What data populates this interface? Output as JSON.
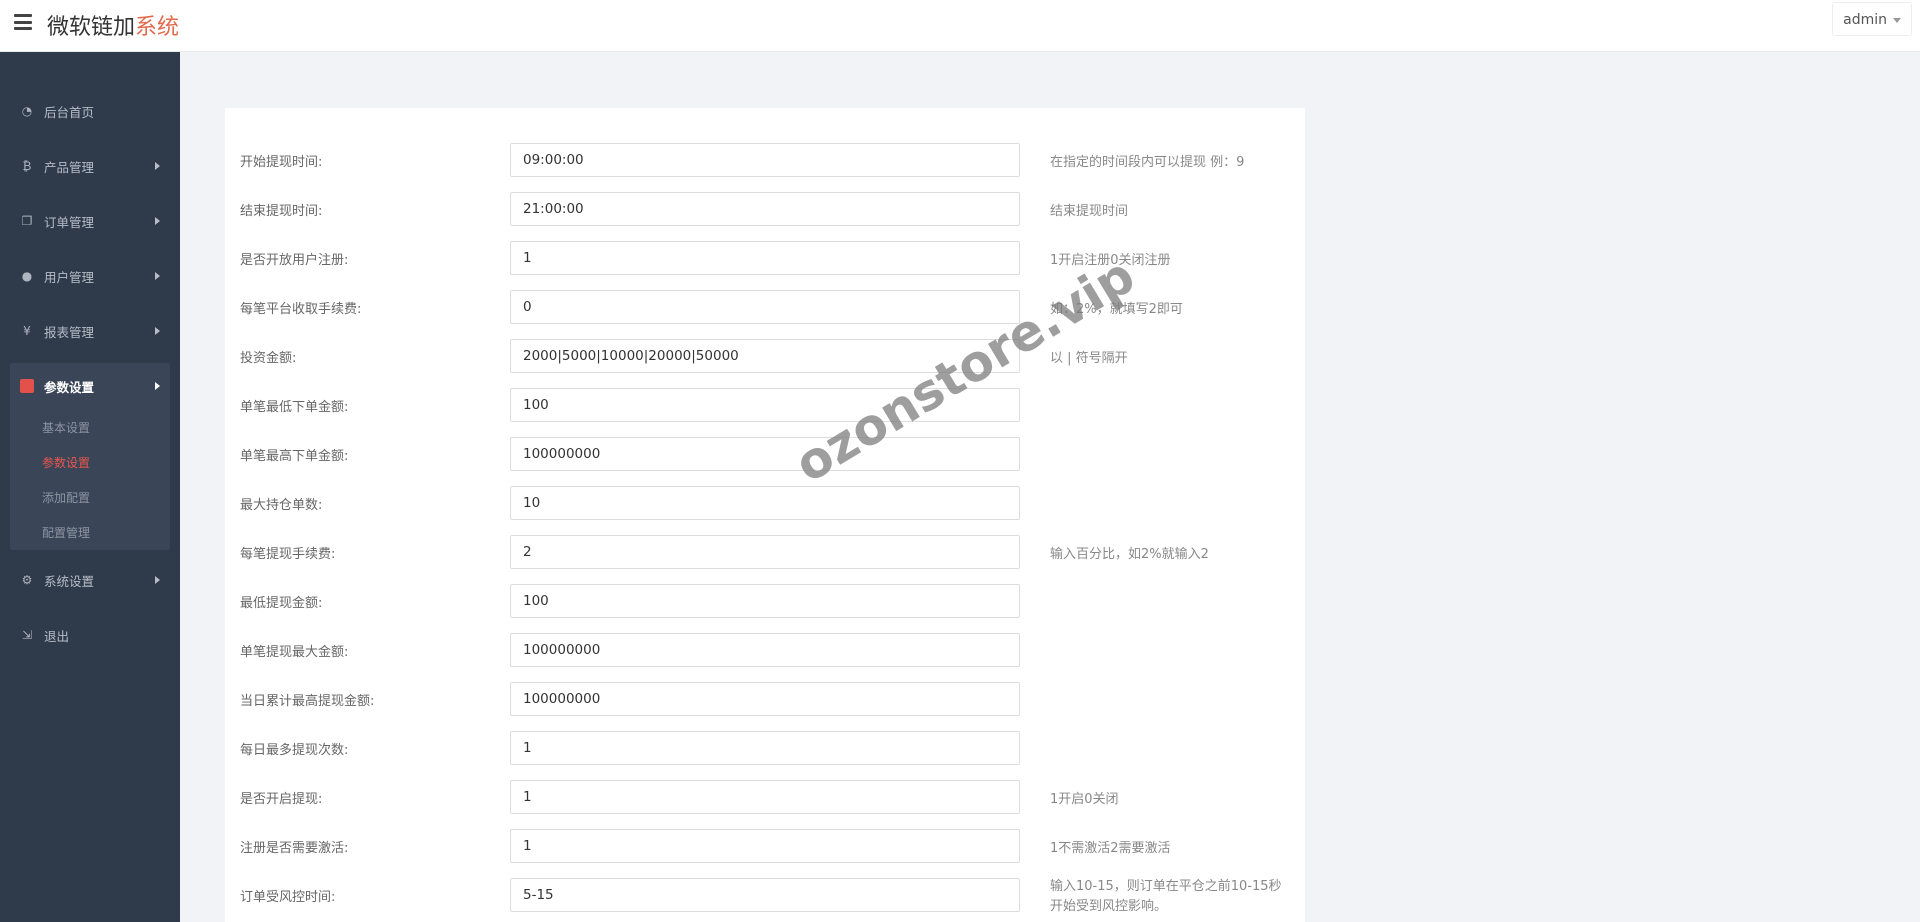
{
  "header": {
    "brand_main": "微软链加",
    "brand_accent": "系统",
    "user": "admin"
  },
  "sidebar": {
    "items": [
      {
        "label": "后台首页",
        "icon": "dashboard-icon"
      },
      {
        "label": "产品管理",
        "icon": "bitcoin-icon"
      },
      {
        "label": "订单管理",
        "icon": "copy-icon"
      },
      {
        "label": "用户管理",
        "icon": "user-icon"
      },
      {
        "label": "报表管理",
        "icon": "yen-icon"
      },
      {
        "label": "参数设置",
        "icon": "files-icon"
      },
      {
        "label": "系统设置",
        "icon": "gears-icon"
      },
      {
        "label": "退出",
        "icon": "sign-out-icon"
      }
    ],
    "sub_items": [
      "基本设置",
      "参数设置",
      "添加配置",
      "配置管理"
    ]
  },
  "form": {
    "rows": [
      {
        "label": "开始提现时间:",
        "value": "09:00:00",
        "hint": "在指定的时间段内可以提现 例：9"
      },
      {
        "label": "结束提现时间:",
        "value": "21:00:00",
        "hint": "结束提现时间"
      },
      {
        "label": "是否开放用户注册:",
        "value": "1",
        "hint": "1开启注册0关闭注册"
      },
      {
        "label": "每笔平台收取手续费:",
        "value": "0",
        "hint": "如：2%，就填写2即可"
      },
      {
        "label": "投资金额:",
        "value": "2000|5000|10000|20000|50000",
        "hint": "以 | 符号隔开"
      },
      {
        "label": "单笔最低下单金额:",
        "value": "100",
        "hint": ""
      },
      {
        "label": "单笔最高下单金额:",
        "value": "100000000",
        "hint": ""
      },
      {
        "label": "最大持仓单数:",
        "value": "10",
        "hint": ""
      },
      {
        "label": "每笔提现手续费:",
        "value": "2",
        "hint": "输入百分比，如2%就输入2"
      },
      {
        "label": "最低提现金额:",
        "value": "100",
        "hint": ""
      },
      {
        "label": "单笔提现最大金额:",
        "value": "100000000",
        "hint": ""
      },
      {
        "label": "当日累计最高提现金额:",
        "value": "100000000",
        "hint": ""
      },
      {
        "label": "每日最多提现次数:",
        "value": "1",
        "hint": ""
      },
      {
        "label": "是否开启提现:",
        "value": "1",
        "hint": "1开启0关闭"
      },
      {
        "label": "注册是否需要激活:",
        "value": "1",
        "hint": "1不需激活2需要激活"
      },
      {
        "label": "订单受风控时间:",
        "value": "5-15",
        "hint_line1": "输入10-15，则订单在平仓之前10-15秒",
        "hint_line2": "开始受到风控影响。"
      }
    ]
  },
  "watermark": "ozonstore.vip"
}
